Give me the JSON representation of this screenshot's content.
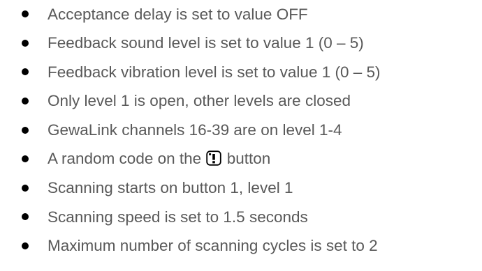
{
  "settings_list": {
    "items": [
      {
        "text": "Acceptance delay is set to value OFF"
      },
      {
        "text": "Feedback sound level is set to value 1 (0 – 5)"
      },
      {
        "text": "Feedback vibration level is set to value 1 (0 – 5)"
      },
      {
        "text": "Only level 1 is open, other levels are closed"
      },
      {
        "text": "GewaLink channels 16-39 are on level 1-4"
      },
      {
        "text_before": "A random code on the",
        "icon": "exclamation-key-icon",
        "text_after": "button"
      },
      {
        "text": "Scanning starts on button 1, level 1"
      },
      {
        "text": "Scanning speed is set to 1.5 seconds"
      },
      {
        "text": "Maximum number of scanning cycles is set to 2"
      }
    ]
  },
  "colors": {
    "text": "#595959",
    "bullet": "#000000"
  }
}
